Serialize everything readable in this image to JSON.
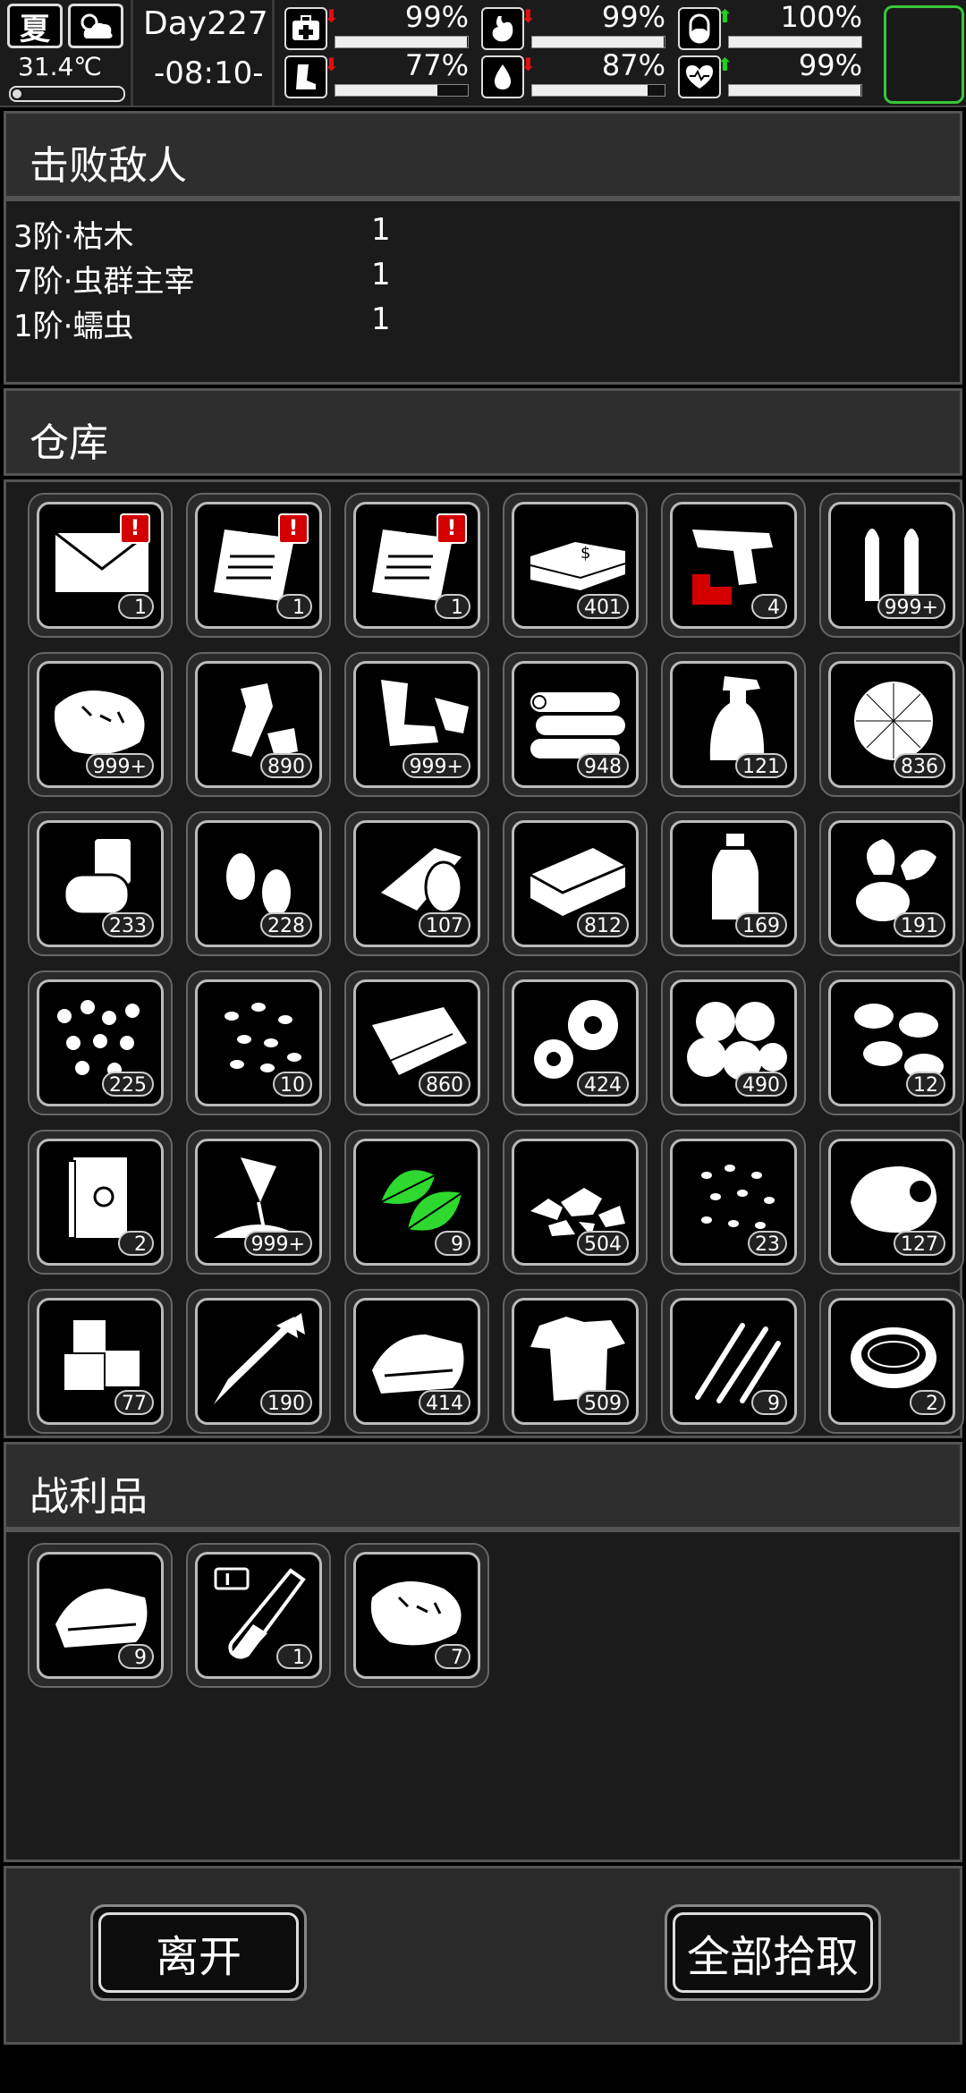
{
  "status": {
    "season": "夏",
    "temperature": "31.4℃",
    "day": "Day227",
    "time": "-08:10-",
    "stats": [
      {
        "icon": "medkit-icon",
        "trend": "down",
        "value": "99%",
        "level": 0.99
      },
      {
        "icon": "stomach-icon",
        "trend": "down",
        "value": "99%",
        "level": 0.99
      },
      {
        "icon": "pill-icon",
        "trend": "up",
        "value": "100%",
        "level": 1.0
      },
      {
        "icon": "boot-icon",
        "trend": "down",
        "value": "77%",
        "level": 0.77
      },
      {
        "icon": "water-drop-icon",
        "trend": "down",
        "value": "87%",
        "level": 0.87
      },
      {
        "icon": "heart-icon",
        "trend": "up",
        "value": "99%",
        "level": 0.99
      }
    ],
    "colors": {
      "down": "#e01010",
      "up": "#20d020",
      "accent": "#38c838"
    }
  },
  "enemies": {
    "title": "击败敌人",
    "rows": [
      {
        "name": "3阶·枯木",
        "count": "1"
      },
      {
        "name": "7阶·虫群主宰",
        "count": "1"
      },
      {
        "name": "1阶·蠕虫",
        "count": "1"
      }
    ]
  },
  "warehouse": {
    "title": "仓库",
    "items": [
      {
        "icon": "envelope-icon",
        "qty": "1",
        "alert": true
      },
      {
        "icon": "clipboard-icon",
        "qty": "1",
        "alert": true
      },
      {
        "icon": "clipboard-icon",
        "qty": "1",
        "alert": true
      },
      {
        "icon": "cash-stack-icon",
        "qty": "401"
      },
      {
        "icon": "flare-gun-icon",
        "qty": "4"
      },
      {
        "icon": "bullets-icon",
        "qty": "999+"
      },
      {
        "icon": "raw-meat-icon",
        "qty": "999+"
      },
      {
        "icon": "plastic-bottle-trash-icon",
        "qty": "890"
      },
      {
        "icon": "scrap-pieces-icon",
        "qty": "999+"
      },
      {
        "icon": "logs-icon",
        "qty": "948"
      },
      {
        "icon": "spray-bottle-icon",
        "qty": "121"
      },
      {
        "icon": "fiber-bundle-icon",
        "qty": "836"
      },
      {
        "icon": "can-icon",
        "qty": "233"
      },
      {
        "icon": "bullet-tips-icon",
        "qty": "228"
      },
      {
        "icon": "bandage-roll-icon",
        "qty": "107"
      },
      {
        "icon": "brick-icon",
        "qty": "812"
      },
      {
        "icon": "water-bottle-icon",
        "qty": "169"
      },
      {
        "icon": "vegetables-icon",
        "qty": "191"
      },
      {
        "icon": "berries-icon",
        "qty": "225"
      },
      {
        "icon": "beans-icon",
        "qty": "10"
      },
      {
        "icon": "cloth-sheet-icon",
        "qty": "860"
      },
      {
        "icon": "gears-icon",
        "qty": "424"
      },
      {
        "icon": "potatoes-icon",
        "qty": "490"
      },
      {
        "icon": "larvae-icon",
        "qty": "12"
      },
      {
        "icon": "book-icon",
        "qty": "2"
      },
      {
        "icon": "flour-bag-icon",
        "qty": "999+"
      },
      {
        "icon": "herb-leaves-icon",
        "qty": "9",
        "green": true
      },
      {
        "icon": "rubble-icon",
        "qty": "504"
      },
      {
        "icon": "seeds-icon",
        "qty": "23"
      },
      {
        "icon": "egg-icon",
        "qty": "127"
      },
      {
        "icon": "ice-cubes-icon",
        "qty": "77"
      },
      {
        "icon": "arrow-icon",
        "qty": "190"
      },
      {
        "icon": "folded-cloth-icon",
        "qty": "414"
      },
      {
        "icon": "ragged-shirt-icon",
        "qty": "509"
      },
      {
        "icon": "claw-marks-icon",
        "qty": "9"
      },
      {
        "icon": "soup-bowl-icon",
        "qty": "2"
      }
    ]
  },
  "loot": {
    "title": "战利品",
    "items": [
      {
        "icon": "folded-cloth-icon",
        "qty": "9"
      },
      {
        "icon": "test-tube-icon",
        "qty": "1"
      },
      {
        "icon": "raw-meat-icon",
        "qty": "7"
      }
    ]
  },
  "buttons": {
    "leave": "离开",
    "take_all": "全部拾取"
  }
}
